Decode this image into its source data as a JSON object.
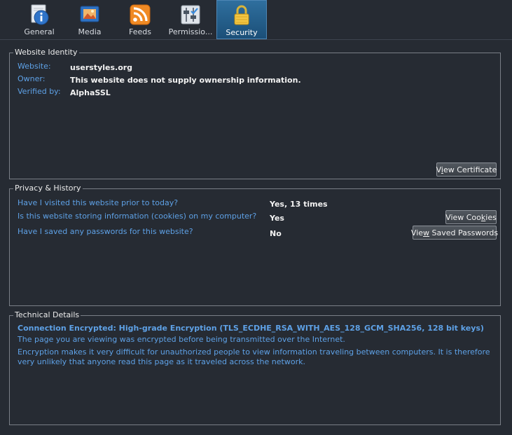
{
  "tabs": [
    {
      "label": "General",
      "icon": "info-icon"
    },
    {
      "label": "Media",
      "icon": "media-icon"
    },
    {
      "label": "Feeds",
      "icon": "rss-feed-icon"
    },
    {
      "label": "Permissio...",
      "icon": "permissions-icon"
    },
    {
      "label": "Security",
      "icon": "lock-icon"
    }
  ],
  "identity": {
    "legend": "Website Identity",
    "website_label": "Website:",
    "website_value": "userstyles.org",
    "owner_label": "Owner:",
    "owner_value": "This website does not supply ownership information.",
    "verified_label": "Verified by:",
    "verified_value": "AlphaSSL",
    "view_certificate_pre": "V",
    "view_certificate_u": "i",
    "view_certificate_post": "ew Certificate"
  },
  "privacy": {
    "legend": "Privacy & History",
    "q1": "Have I visited this website prior to today?",
    "a1": "Yes, 13 times",
    "q2": "Is this website storing information (cookies) on my computer?",
    "a2": "Yes",
    "view_cookies_pre": "View Coo",
    "view_cookies_u": "k",
    "view_cookies_post": "ies",
    "q3": "Have I saved any passwords for this website?",
    "a3": "No",
    "view_passwords_pre": "Vie",
    "view_passwords_u": "w",
    "view_passwords_post": " Saved Passwords"
  },
  "technical": {
    "legend": "Technical Details",
    "heading": "Connection Encrypted: High-grade Encryption (TLS_ECDHE_RSA_WITH_AES_128_GCM_SHA256, 128 bit keys)",
    "line1": "The page you are viewing was encrypted before being transmitted over the Internet.",
    "line2": "Encryption makes it very difficult for unauthorized people to view information traveling between computers. It is therefore very unlikely that anyone read this page as it traveled across the network."
  },
  "colors": {
    "background": "#262b33",
    "label_blue": "#5ea1e6",
    "active_tab": "#2f6f9e"
  }
}
